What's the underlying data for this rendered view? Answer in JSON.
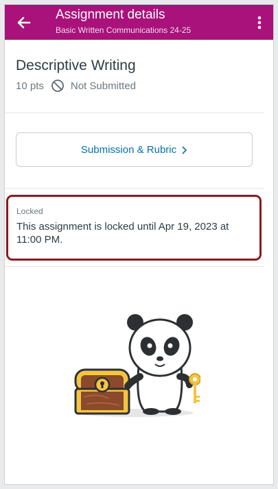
{
  "header": {
    "title": "Assignment details",
    "subtitle": "Basic Written Communications 24-25",
    "back_icon": "arrow-left-icon",
    "more_icon": "more-vertical-icon",
    "bar_color": "#a8127a"
  },
  "assignment": {
    "title": "Descriptive Writing",
    "points": "10 pts",
    "status_icon": "not-submitted-icon",
    "status": "Not Submitted"
  },
  "actions": {
    "submission_label": "Submission & Rubric",
    "link_color": "#0770a3"
  },
  "lock_notice": {
    "label": "Locked",
    "message": "This assignment is locked until Apr 19, 2023 at 11:00 PM.",
    "highlight_color": "#8b1a1f"
  },
  "illustration": {
    "name": "panda-treasure-chest-key-illustration"
  }
}
